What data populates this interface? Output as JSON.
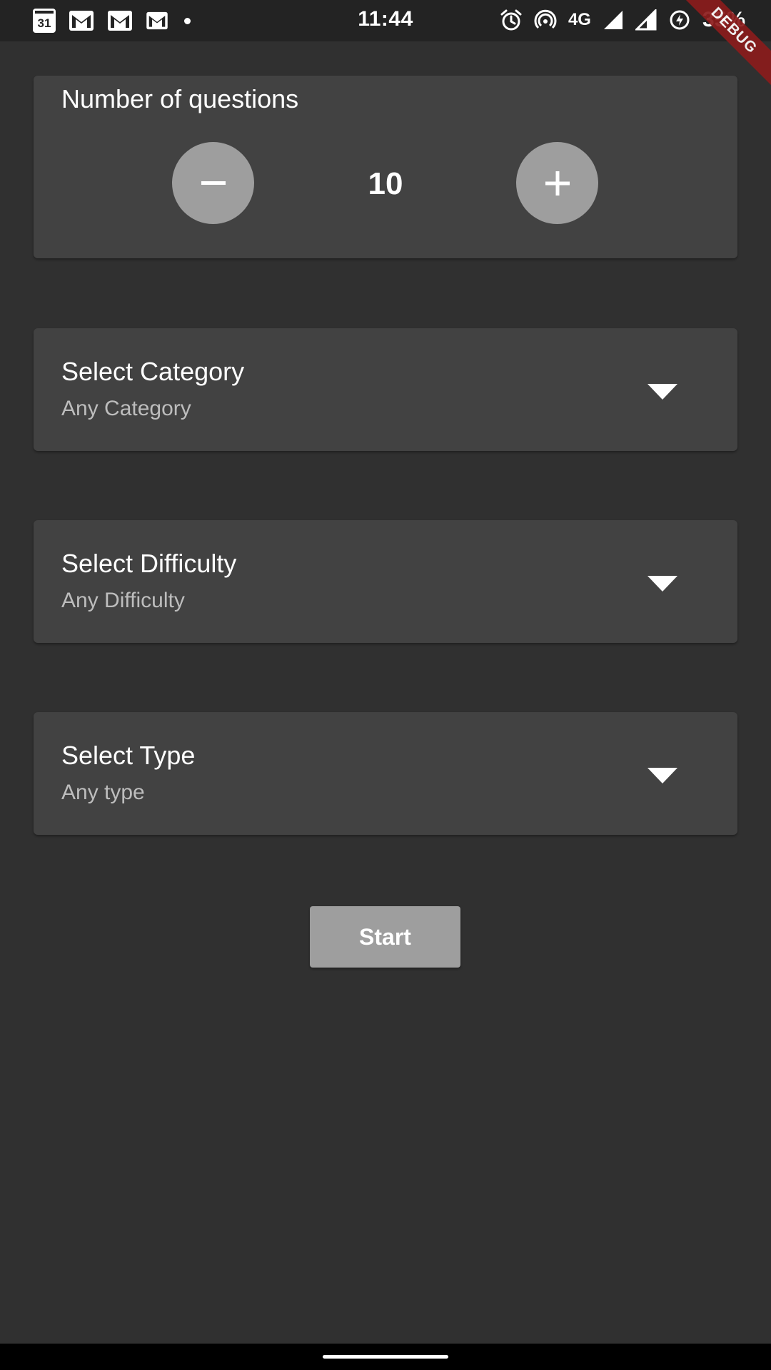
{
  "status_bar": {
    "time": "11:44",
    "calendar_day": "31",
    "network": "4G",
    "battery": "35%",
    "left_icons": [
      "calendar-icon",
      "gmail-icon",
      "gmail-icon",
      "gmail-icon",
      "dot-icon"
    ],
    "right_icons": [
      "alarm-icon",
      "hotspot-icon",
      "signal-icon",
      "signal-icon",
      "battery-saver-icon"
    ]
  },
  "debug_banner": "DEBUG",
  "questions": {
    "label": "Number of questions",
    "count": "10",
    "decrement_icon": "minus-icon",
    "increment_icon": "plus-icon"
  },
  "category": {
    "label": "Select Category",
    "value": "Any Category"
  },
  "difficulty": {
    "label": "Select Difficulty",
    "value": "Any Difficulty"
  },
  "type": {
    "label": "Select Type",
    "value": "Any type"
  },
  "start_button": {
    "label": "Start"
  },
  "colors": {
    "background": "#303030",
    "card": "#424242",
    "button": "#9e9e9e",
    "subtitle": "#bdbdbd",
    "debug_ribbon": "#8b1c1c"
  }
}
